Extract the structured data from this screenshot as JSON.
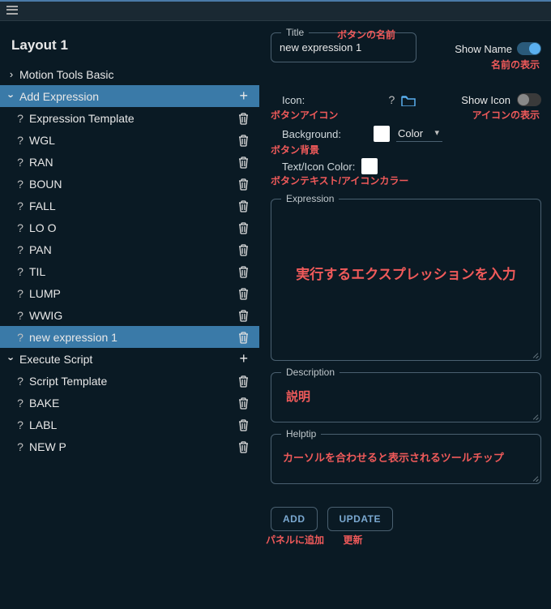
{
  "topbar": {
    "menu": "menu"
  },
  "sidebar": {
    "layout_title": "Layout 1",
    "sections": [
      {
        "label": "Motion Tools Basic",
        "expanded": false,
        "kind": "plain"
      },
      {
        "label": "Add Expression",
        "expanded": true,
        "kind": "highlighted",
        "items": [
          {
            "label": "Expression Template",
            "selected": false
          },
          {
            "label": "WGL",
            "selected": false
          },
          {
            "label": "RAN",
            "selected": false
          },
          {
            "label": "BOUN",
            "selected": false
          },
          {
            "label": "FALL",
            "selected": false
          },
          {
            "label": "LO O",
            "selected": false
          },
          {
            "label": "PAN",
            "selected": false
          },
          {
            "label": "TIL",
            "selected": false
          },
          {
            "label": "LUMP",
            "selected": false
          },
          {
            "label": "WWIG",
            "selected": false
          },
          {
            "label": "new expression 1",
            "selected": true
          }
        ]
      },
      {
        "label": "Execute Script",
        "expanded": true,
        "kind": "plain",
        "items": [
          {
            "label": "Script Template",
            "selected": false
          },
          {
            "label": "BAKE",
            "selected": false
          },
          {
            "label": "LABL",
            "selected": false
          },
          {
            "label": "NEW P",
            "selected": false
          }
        ]
      }
    ]
  },
  "panel": {
    "title_label": "Title",
    "title_value": "new expression 1",
    "show_name_label": "Show Name",
    "show_name_on": true,
    "icon_label": "Icon:",
    "show_icon_label": "Show Icon",
    "show_icon_on": false,
    "background_label": "Background:",
    "color_select": "Color",
    "texticon_label": "Text/Icon Color:",
    "expression_label": "Expression",
    "description_label": "Description",
    "helptip_label": "Helptip",
    "add_button": "ADD",
    "update_button": "UPDATE"
  },
  "annotations": {
    "title": "ボタンの名前",
    "show_name": "名前の表示",
    "icon": "ボタンアイコン",
    "show_icon": "アイコンの表示",
    "background": "ボタン背景",
    "texticon": "ボタンテキスト/アイコンカラー",
    "expression": "実行するエクスプレッションを入力",
    "description": "説明",
    "helptip": "カーソルを合わせると表示されるツールチップ",
    "add": "パネルに追加",
    "update": "更新"
  }
}
